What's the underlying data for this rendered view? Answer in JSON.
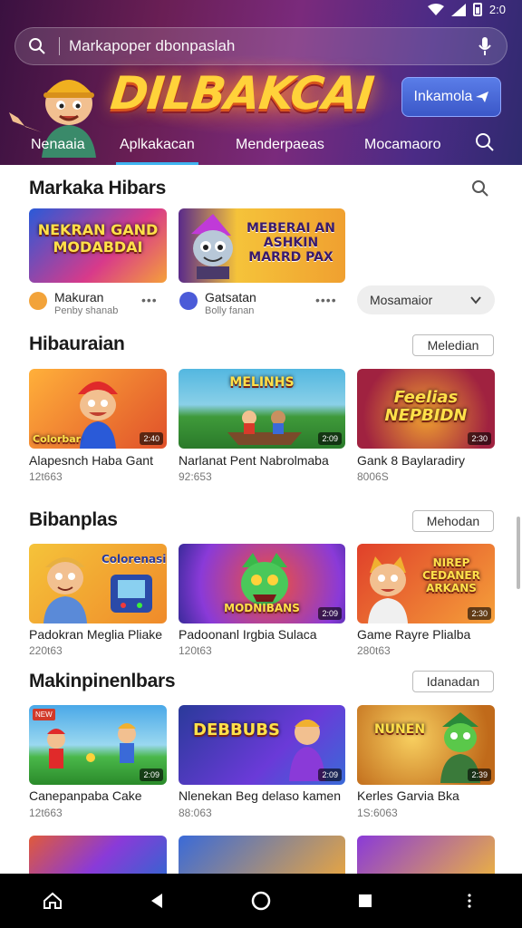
{
  "status_bar": {
    "time": "2:0"
  },
  "header": {
    "search_placeholder": "Markapoper dbonpaslah",
    "logo_text": "DILBAKCAI",
    "cta_label": "Inkamola",
    "tabs": [
      {
        "label": "Nenaaia",
        "active": false
      },
      {
        "label": "Aplkakacan",
        "active": true
      },
      {
        "label": "Menderpaeas",
        "active": false
      },
      {
        "label": "Mocamaoro",
        "active": false
      }
    ]
  },
  "featured": {
    "title": "Markaka Hibars",
    "items": [
      {
        "thumb_title": "NEKRAN GAND MODABDAI",
        "name": "Makuran",
        "sub": "Penby shanab",
        "fav_color": "#f2a33a"
      },
      {
        "thumb_title": "MEBERAI AN ASHKIN MARRD PAX",
        "name": "Gatsatan",
        "sub": "Bolly fanan",
        "fav_color": "#4b5bd8"
      }
    ],
    "dropdown_label": "Mosamaior"
  },
  "sections": [
    {
      "title": "Hibauraian",
      "more_label": "Meledian",
      "cards": [
        {
          "name": "Alapesnch Haba Gant",
          "sub": "12t663",
          "thumb_title": "Colorbar",
          "badge": "2:40",
          "colors": [
            "#ffb03a",
            "#e0502a"
          ]
        },
        {
          "name": "Narlanat Pent Nabrolmaba",
          "sub": "92:653",
          "thumb_title": "MELINHS",
          "badge": "2:09",
          "colors": [
            "#53b7e0",
            "#3f9a3a"
          ]
        },
        {
          "name": "Gank 8 Baylaradiry",
          "sub": "8006S",
          "thumb_title": "Feelias NEPBIDN",
          "badge": "2:30",
          "colors": [
            "#a02240",
            "#e07a30"
          ]
        }
      ]
    },
    {
      "title": "Bibanplas",
      "more_label": "Mehodan",
      "cards": [
        {
          "name": "Padokran Meglia Pliake",
          "sub": "220t63",
          "thumb_title": "Colorenasi",
          "badge": "",
          "colors": [
            "#f5c33a",
            "#ef8a2a"
          ]
        },
        {
          "name": "Padoonanl Irgbia Sulaca",
          "sub": "120t63",
          "thumb_title": "MODNIBANS",
          "badge": "2:09",
          "colors": [
            "#8a3ad8",
            "#f0503a"
          ]
        },
        {
          "name": "Game Rayre Plialba",
          "sub": "280t63",
          "thumb_title": "NIREP CEDANER ARKANS",
          "badge": "2:30",
          "colors": [
            "#e0402a",
            "#f5a03a"
          ]
        }
      ]
    },
    {
      "title": "Makinpinenlbars",
      "more_label": "Idanadan",
      "cards": [
        {
          "name": "Canepanpaba Cake",
          "sub": "12t663",
          "thumb_title": "",
          "badge": "2:09",
          "colors": [
            "#4aa8e8",
            "#4ab84a"
          ]
        },
        {
          "name": "Nlenekan Beg delaso kamen",
          "sub": "88:063",
          "thumb_title": "DEBBUBS",
          "badge": "2:09",
          "colors": [
            "#2a3a9a",
            "#6a3ad8"
          ]
        },
        {
          "name": "Kerles Garvia Bka",
          "sub": "1S:6063",
          "thumb_title": "NUNEN",
          "badge": "2:39",
          "colors": [
            "#f0a83a",
            "#c06a1a"
          ]
        }
      ]
    },
    {
      "title": "",
      "more_label": "",
      "cards": [
        {
          "name": "",
          "sub": "",
          "thumb_title": "",
          "badge": "",
          "colors": [
            "#e05a3a",
            "#2a6ad0"
          ]
        },
        {
          "name": "",
          "sub": "",
          "thumb_title": "",
          "badge": "",
          "colors": [
            "#3a6ad8",
            "#f0a83a"
          ]
        },
        {
          "name": "",
          "sub": "",
          "thumb_title": "",
          "badge": "",
          "colors": [
            "#8a3ad8",
            "#f0b83a"
          ]
        }
      ]
    }
  ],
  "icons": {
    "search": "search-icon",
    "mic": "mic-icon",
    "home": "home-icon",
    "back": "back-icon",
    "circle": "home-circle-icon",
    "recents": "recents-icon",
    "more": "more-vert-icon"
  }
}
